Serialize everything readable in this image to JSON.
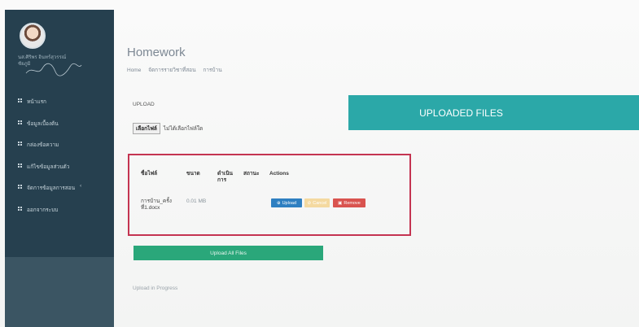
{
  "sidebar": {
    "user_name": "นส.ศิริพร อินทร์สุวรรณ์\nชัยภูมิ",
    "items": [
      {
        "label": "หน้าแรก"
      },
      {
        "label": "ข้อมูลเบื้องต้น"
      },
      {
        "label": "กล่องข้อความ"
      },
      {
        "label": "แก้ไขข้อมูลส่วนตัว"
      },
      {
        "label": "จัดการข้อมูลการสอน"
      },
      {
        "label": "ออกจากระบบ"
      }
    ],
    "chevron": "‹"
  },
  "header": {
    "title": "Homework",
    "breadcrumb": [
      "Home",
      "จัดการรายวิชาที่สอน",
      "การบ้าน"
    ]
  },
  "upload": {
    "label": "UPLOAD",
    "choose_button": "เลือกไฟล์",
    "no_file_text": "ไม่ได้เลือกไฟล์ใด"
  },
  "uploaded_files": {
    "title": "UPLOADED FILES"
  },
  "queue": {
    "columns": [
      "ชื่อไฟล์",
      "ขนาด",
      "ดำเนินการ",
      "สถานะ",
      "Actions"
    ],
    "files": [
      {
        "name": "การบ้าน_ครั้งที่1.docx",
        "size": "0.01 MB"
      }
    ],
    "actions": {
      "upload": "Upload",
      "cancel": "Cancel",
      "remove": "Remove"
    }
  },
  "upload_all_label": "Upload All Files",
  "progress_label": "Upload in Progress",
  "colors": {
    "sidebar": "#26404f",
    "banner": "#2ba8a8",
    "queue_border": "#c43451",
    "upload_all": "#2aa77a",
    "btn_upload": "#2e7fc1",
    "btn_remove": "#d9534f"
  }
}
